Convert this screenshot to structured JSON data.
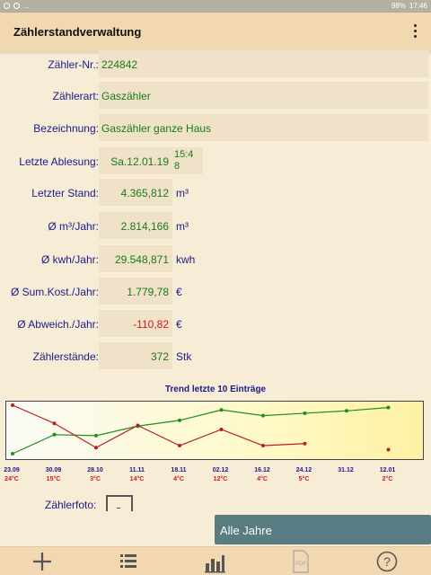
{
  "status_bar": {
    "left": "...",
    "battery": "98%",
    "time": "17:46"
  },
  "app_bar": {
    "title": "Zählerstandverwaltung",
    "menu_icon": "overflow-menu-icon"
  },
  "fields": [
    {
      "label": "Zähler-Nr.:",
      "value": "224842",
      "unit": ""
    },
    {
      "label": "Zählerart:",
      "value": "Gaszähler",
      "unit": ""
    },
    {
      "label": "Bezeichnung:",
      "value": "Gaszähler ganze Haus",
      "unit": ""
    },
    {
      "label": "Letzte Ablesung:",
      "value": "Sa.12.01.19",
      "time_line1": "15:4",
      "time_line2": "8",
      "unit": ""
    },
    {
      "label": "Letzter Stand:",
      "value": "4.365,812",
      "unit": "m³"
    },
    {
      "label": "Ø m³/Jahr:",
      "value": "2.814,166",
      "unit": "m³"
    },
    {
      "label": "Ø kwh/Jahr:",
      "value": "29.548,871",
      "unit": "kwh"
    },
    {
      "label": "Ø Sum.Kost./Jahr:",
      "value": "1.779,78",
      "unit": "€"
    },
    {
      "label": "Ø Abweich./Jahr:",
      "value": "-110,82",
      "unit": "€"
    },
    {
      "label": "Zählerstände:",
      "value": "372",
      "unit": "Stk"
    }
  ],
  "trend": {
    "title": "Trend letzte 10 Einträge",
    "colors": {
      "consumption": "#1e8f1e",
      "temperature": "#b3201c"
    }
  },
  "chart_data": {
    "type": "line",
    "categories": [
      "23.09",
      "30.09",
      "28.10",
      "11.11",
      "18.11",
      "02.12",
      "16.12",
      "24.12",
      "31.12",
      "12.01"
    ],
    "temperature_labels": [
      "24°C",
      "15°C",
      "3°C",
      "14°C",
      "4°C",
      "12°C",
      "4°C",
      "5°C",
      "2°C"
    ],
    "series": [
      {
        "values": [
          0.0,
          0.4,
          0.38,
          0.58,
          0.7,
          0.92,
          0.8,
          0.85,
          0.9,
          0.97
        ]
      },
      {
        "values": [
          24,
          15,
          3,
          14,
          4,
          12,
          4,
          5,
          null,
          2
        ],
        "segments": [
          [
            0,
            7
          ],
          [
            9,
            9
          ]
        ]
      }
    ]
  },
  "foto": {
    "label": "Zählerfoto:"
  },
  "year_button": {
    "label": "Alle Jahre"
  },
  "bottom_bar": {
    "icons": [
      "add-icon",
      "list-icon",
      "bar-chart-icon",
      "pdf-icon",
      "help-icon"
    ],
    "pdf_text": "PDF",
    "help_text": "?"
  }
}
